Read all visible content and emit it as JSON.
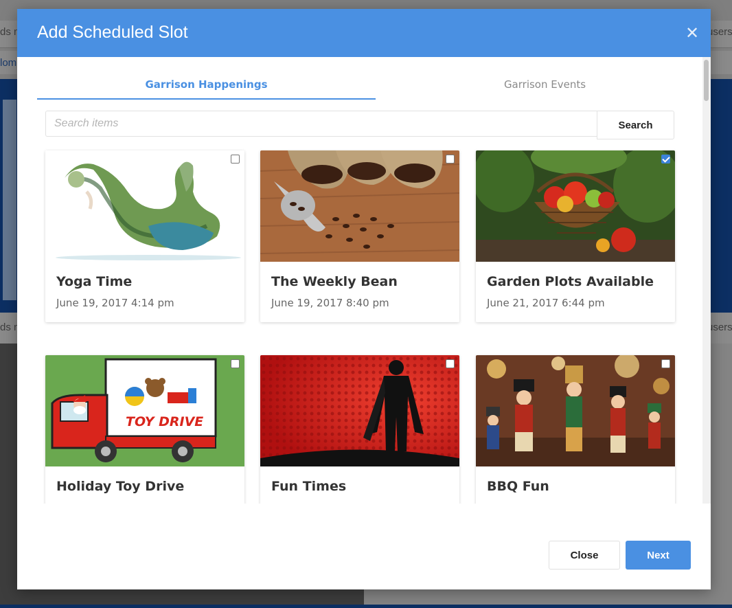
{
  "background": {
    "left_text_top": "ds n",
    "left_text_second": "lom",
    "right_text_top": "users",
    "left_text_mid": "ds n",
    "right_text_mid": "users"
  },
  "modal": {
    "title": "Add Scheduled Slot",
    "close_icon": "close-icon",
    "tabs": [
      {
        "label": "Garrison Happenings",
        "active": true
      },
      {
        "label": "Garrison Events",
        "active": false
      }
    ],
    "search": {
      "placeholder": "Search items",
      "value": "",
      "button_label": "Search"
    },
    "cards": [
      {
        "title": "Yoga Time",
        "date": "June 19, 2017 4:14 pm",
        "checked": false,
        "image": "yoga-pose-forest"
      },
      {
        "title": "The Weekly Bean",
        "date": "June 19, 2017 8:40 pm",
        "checked": false,
        "image": "coffee-beans-sacks"
      },
      {
        "title": "Garden Plots Available",
        "date": "June 21, 2017 6:44 pm",
        "checked": true,
        "image": "tomato-basket"
      },
      {
        "title": "Holiday Toy Drive",
        "date": "",
        "checked": false,
        "image": "toy-drive-truck"
      },
      {
        "title": "Fun Times",
        "date": "",
        "checked": false,
        "image": "superhero-silhouette"
      },
      {
        "title": "BBQ Fun",
        "date": "",
        "checked": false,
        "image": "nutcracker-figures"
      }
    ],
    "toy_drive_text": "TOY DRIVE",
    "footer": {
      "close_label": "Close",
      "next_label": "Next"
    }
  },
  "colors": {
    "primary": "#4a90e2",
    "checked": "#3b82d9"
  }
}
